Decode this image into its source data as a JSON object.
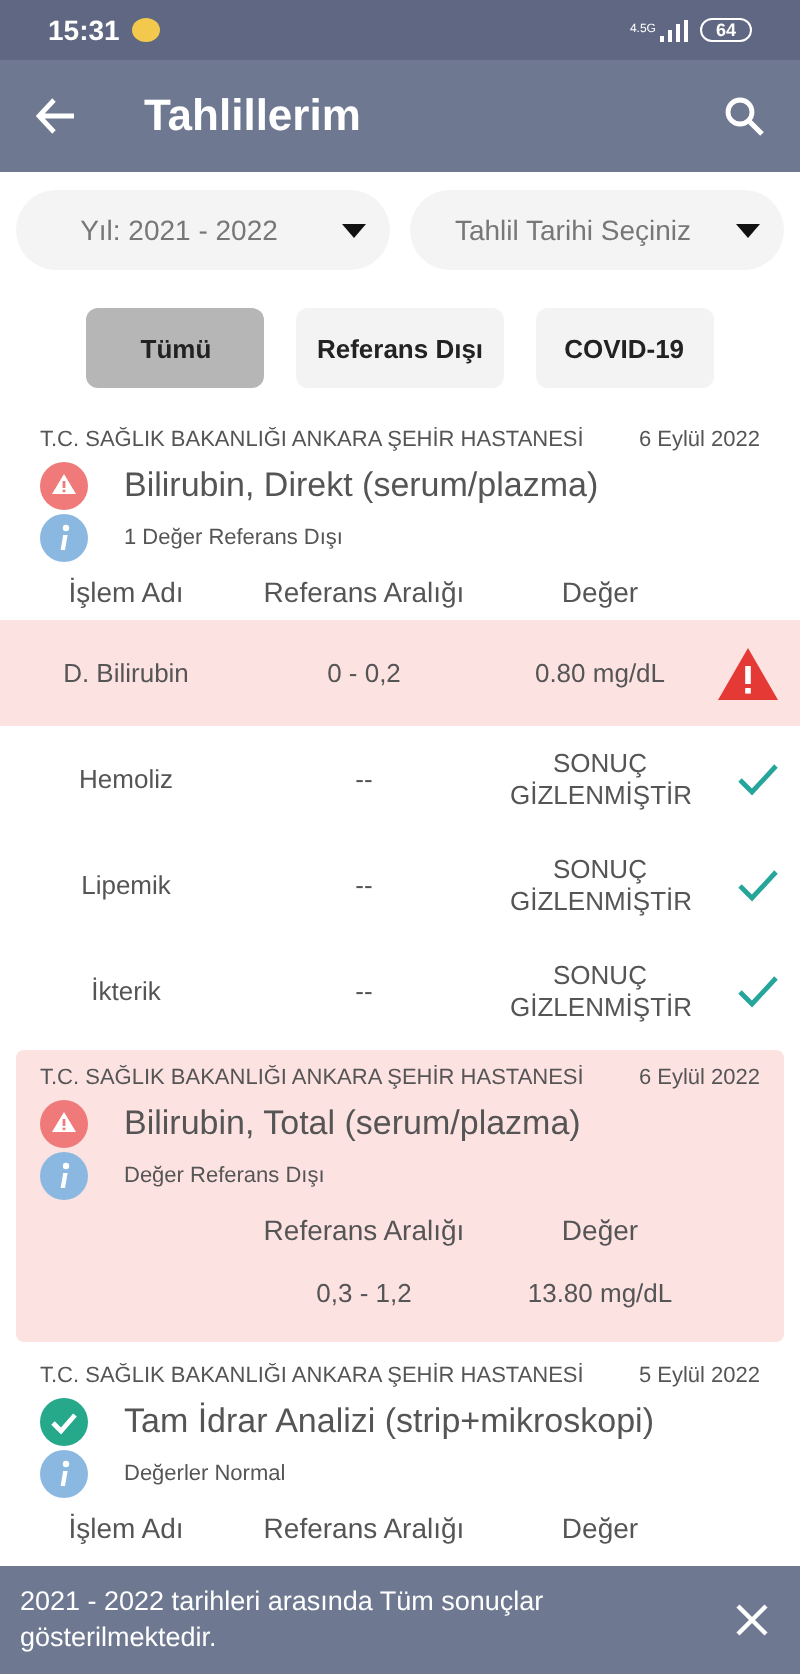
{
  "status_bar": {
    "time": "15:31",
    "network": "4.5G",
    "battery": "64"
  },
  "app_bar": {
    "title": "Tahlillerim"
  },
  "filters": [
    {
      "label": "Yıl: 2021 - 2022"
    },
    {
      "label": "Tahlil Tarihi Seçiniz"
    }
  ],
  "chips": [
    {
      "label": "Tümü",
      "selected": true
    },
    {
      "label": "Referans Dışı",
      "selected": false
    },
    {
      "label": "COVID-19",
      "selected": false
    }
  ],
  "results": [
    {
      "kind": "detailed",
      "hospital": "T.C. SAĞLIK BAKANLIĞI ANKARA ŞEHİR HASTANESİ",
      "date": "6 Eylül 2022",
      "out_of_range": true,
      "highlighted": false,
      "title": "Bilirubin, Direkt (serum/plazma)",
      "note": "1 Değer Referans Dışı",
      "columns": [
        "İşlem Adı",
        "Referans Aralığı",
        "Değer"
      ],
      "rows": [
        {
          "name": "D. Bilirubin",
          "range": "0 - 0,2",
          "value": "0.80 mg/dL",
          "out_of_range": true
        },
        {
          "name": "Hemoliz",
          "range": "--",
          "value": "SONUÇ GİZLENMİŞTİR",
          "out_of_range": false
        },
        {
          "name": "Lipemik",
          "range": "--",
          "value": "SONUÇ GİZLENMİŞTİR",
          "out_of_range": false
        },
        {
          "name": "İkterik",
          "range": "--",
          "value": "SONUÇ GİZLENMİŞTİR",
          "out_of_range": false
        }
      ]
    },
    {
      "kind": "summary",
      "hospital": "T.C. SAĞLIK BAKANLIĞI ANKARA ŞEHİR HASTANESİ",
      "date": "6 Eylül 2022",
      "out_of_range": true,
      "highlighted": true,
      "title": "Bilirubin, Total (serum/plazma)",
      "note": "Değer Referans Dışı",
      "columns": [
        "Referans Aralığı",
        "Değer"
      ],
      "rows": [
        {
          "range": "0,3 - 1,2",
          "value": "13.80 mg/dL"
        }
      ]
    },
    {
      "kind": "detailed",
      "hospital": "T.C. SAĞLIK BAKANLIĞI ANKARA ŞEHİR HASTANESİ",
      "date": "5 Eylül 2022",
      "out_of_range": false,
      "highlighted": false,
      "title": "Tam İdrar Analizi (strip+mikroskopi)",
      "note": "Değerler Normal",
      "columns": [
        "İşlem Adı",
        "Referans Aralığı",
        "Değer"
      ]
    }
  ],
  "snackbar": {
    "message": "2021 - 2022 tarihleri arasında Tüm sonuçlar gösterilmektedir."
  }
}
